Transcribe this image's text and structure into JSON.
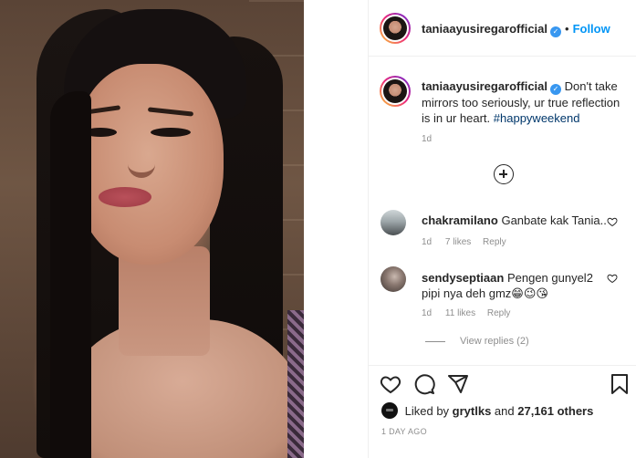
{
  "post": {
    "username": "taniaayusiregarofficial",
    "follow_label": "Follow",
    "follow_separator": "•",
    "caption": "Don't take mirrors too seriously, ur true reflection is in ur heart.",
    "hashtag": "#happyweekend",
    "caption_age": "1d"
  },
  "comments": [
    {
      "username": "chakramilano",
      "text": "Ganbate kak Tania..",
      "age": "1d",
      "likes": "7 likes",
      "reply": "Reply"
    },
    {
      "username": "sendyseptiaan",
      "text": "Pengen gunyel2 pipi nya deh gmz😁😉😘",
      "age": "1d",
      "likes": "11 likes",
      "reply": "Reply",
      "view_replies": "View replies (2)"
    }
  ],
  "footer": {
    "liked_by_prefix": "Liked by ",
    "liked_by_user": "grytlks",
    "liked_by_middle": " and ",
    "liked_by_count": "27,161 others",
    "timestamp": "1 DAY AGO"
  },
  "icons": {
    "like": "heart-icon",
    "comment": "comment-icon",
    "share": "paper-plane-icon",
    "save": "bookmark-icon",
    "add_comment": "plus-circle-icon",
    "verified": "verified-badge-icon"
  },
  "colors": {
    "link_blue": "#0095f6",
    "verified_blue": "#3897f0",
    "hashtag": "#00376b",
    "muted_text": "#8e8e8e",
    "divider": "#efefef"
  }
}
